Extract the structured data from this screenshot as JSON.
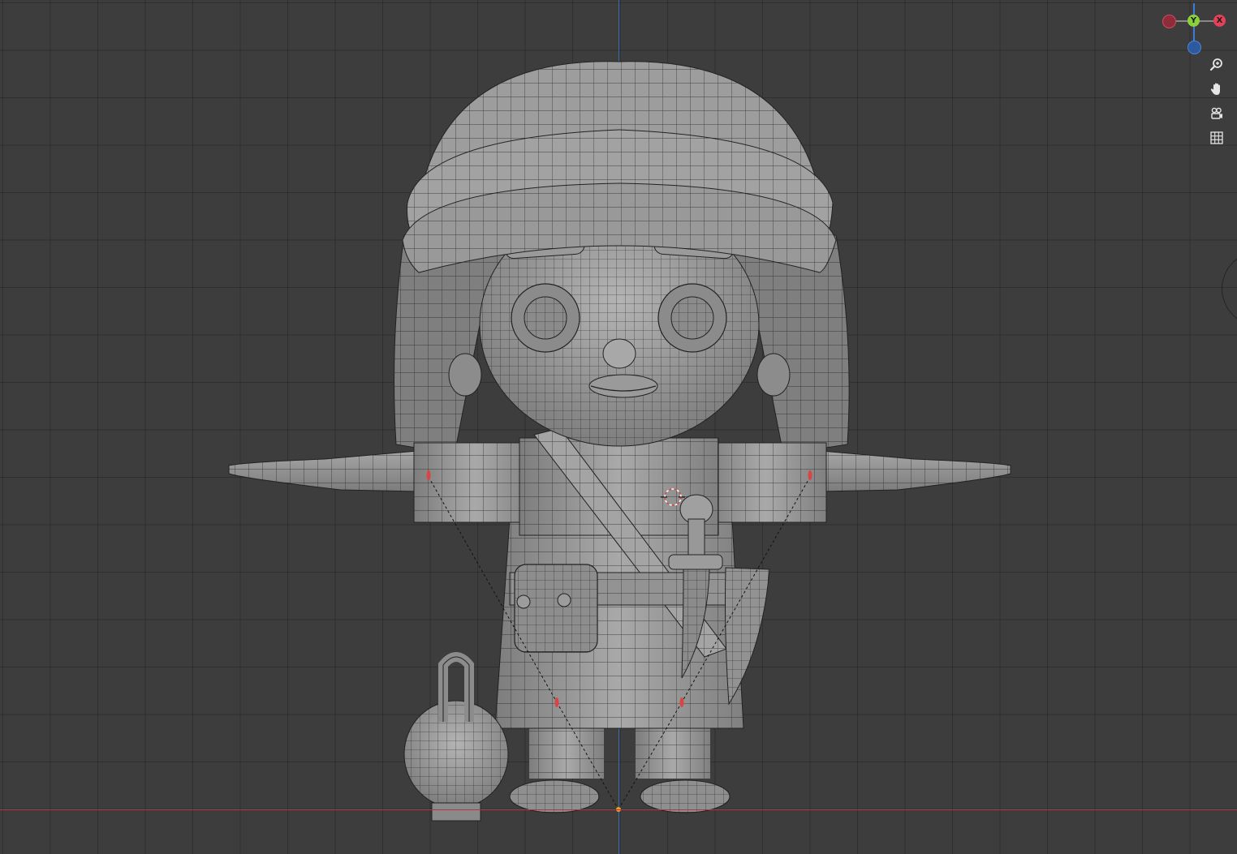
{
  "gizmo": {
    "y_label": "Y",
    "x_label": "X",
    "colors": {
      "x": "#e3405a",
      "x_neg": "#8f2c3a",
      "y": "#8bd13b",
      "z": "#3f7bd6",
      "z_neg": "#2d5a9e"
    }
  },
  "navigation": {
    "zoom": {
      "icon": "zoom-icon"
    },
    "pan": {
      "icon": "hand-icon"
    },
    "camera": {
      "icon": "camera-icon"
    },
    "grid": {
      "icon": "grid-icon"
    }
  },
  "colors": {
    "background": "#3d3d3d",
    "grid": "#2f2f2f",
    "x_axis": "#b0393f",
    "y_axis": "#3a6db5",
    "mesh": "#9a9a9a",
    "wire": "#1e1e1e"
  }
}
